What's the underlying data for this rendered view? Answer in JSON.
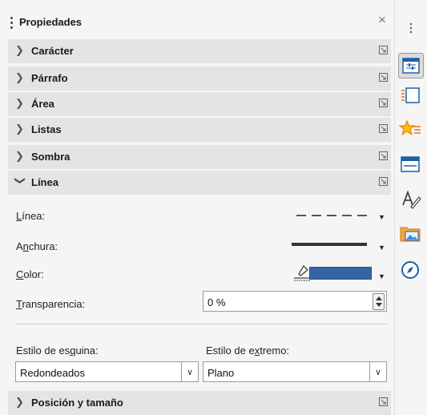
{
  "panel": {
    "title": "Propiedades",
    "close_glyph": "×"
  },
  "sections": [
    {
      "label": "Carácter",
      "expanded": false
    },
    {
      "label": "Párrafo",
      "expanded": false
    },
    {
      "label": "Área",
      "expanded": false
    },
    {
      "label": "Listas",
      "expanded": false
    },
    {
      "label": "Sombra",
      "expanded": false
    },
    {
      "label": "Línea",
      "expanded": true
    },
    {
      "label": "Posición y tamaño",
      "expanded": false
    }
  ],
  "line_section": {
    "line_style": {
      "label_pre": "",
      "label_key": "L",
      "label_post": "ínea:",
      "value": "dashed"
    },
    "width": {
      "label_pre": "A",
      "label_key": "n",
      "label_post": "chura:"
    },
    "color": {
      "label_pre": "",
      "label_key": "C",
      "label_post": "olor:",
      "value": "#3465a4"
    },
    "transparency": {
      "label_pre": "",
      "label_key": "T",
      "label_post": "ransparencia:",
      "value": "0 %"
    },
    "corner_style": {
      "label_pre": "Estilo de es",
      "label_key": "q",
      "label_post": "uina:",
      "value": "Redondeados"
    },
    "cap_style": {
      "label_pre": "Estilo de e",
      "label_key": "x",
      "label_post": "tremo:",
      "value": "Plano"
    }
  },
  "deck": {
    "icons": [
      "sidebar-menu-icon",
      "properties-icon",
      "page-icon",
      "styles-icon",
      "gallery-icon",
      "navigator-icon"
    ],
    "active": "properties-icon"
  },
  "colors": {
    "accent_blue": "#3465a4",
    "header_bg": "#e4e4e4"
  }
}
